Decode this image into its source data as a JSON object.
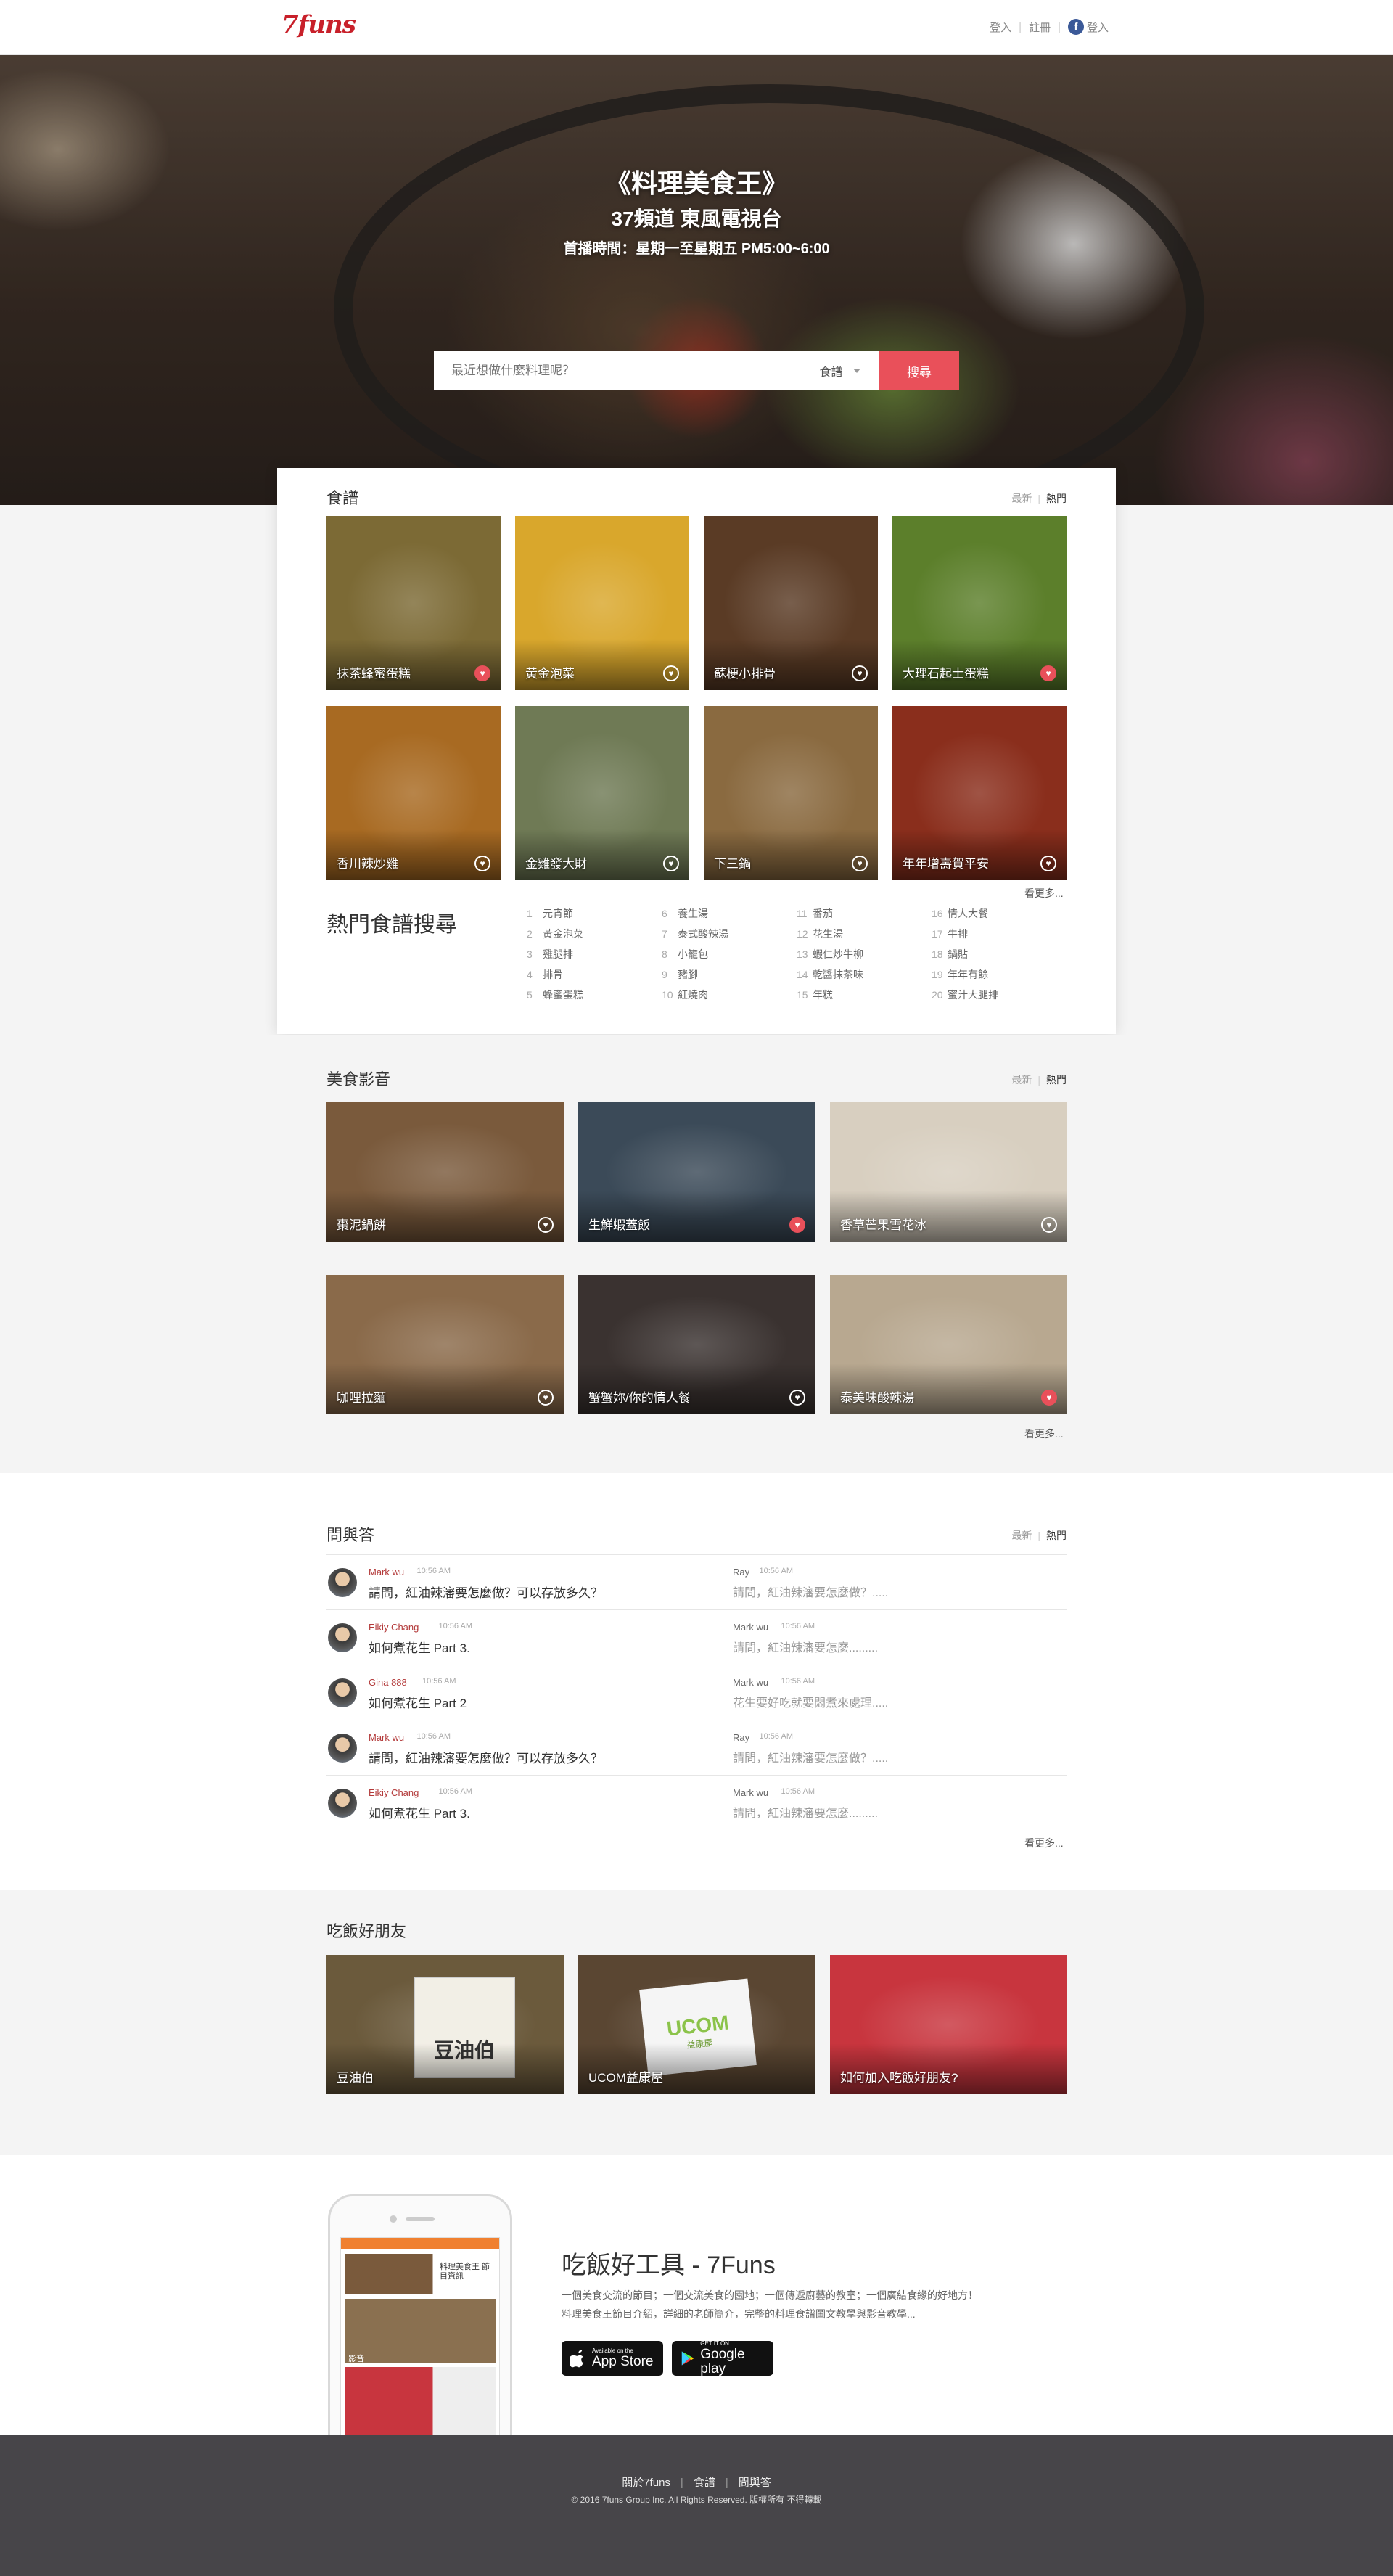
{
  "header": {
    "logo": "7funs",
    "login": "登入",
    "register": "註冊",
    "fb_login": "登入"
  },
  "hero": {
    "title": "《料理美食王》",
    "subtitle": "37頻道 東風電視台",
    "schedule": "首播時間：星期一至星期五 PM5:00~6:00",
    "search_placeholder": "最近想做什麼料理呢？",
    "search_category": "食譜",
    "search_button": "搜尋"
  },
  "recipes": {
    "title": "食譜",
    "sort_new": "最新",
    "sort_hot": "熱門",
    "items": [
      {
        "label": "抹茶蜂蜜蛋糕",
        "liked": true,
        "color": "#7c6a35"
      },
      {
        "label": "黃金泡菜",
        "liked": false,
        "color": "#d9a72c"
      },
      {
        "label": "蘇梗小排骨",
        "liked": false,
        "color": "#5a3b25"
      },
      {
        "label": "大理石起士蛋糕",
        "liked": true,
        "color": "#5c7f2b"
      },
      {
        "label": "香川辣炒雞",
        "liked": false,
        "color": "#a86a22"
      },
      {
        "label": "金雞發大財",
        "liked": false,
        "color": "#6f7a55"
      },
      {
        "label": "下三鍋",
        "liked": false,
        "color": "#8a6a40"
      },
      {
        "label": "年年增壽賀平安",
        "liked": false,
        "color": "#8a2e1c"
      }
    ],
    "more": "看更多..."
  },
  "hot_search": {
    "title": "熱門食譜搜尋",
    "columns": [
      [
        {
          "n": "1",
          "t": "元宵節"
        },
        {
          "n": "2",
          "t": "黃金泡菜"
        },
        {
          "n": "3",
          "t": "雞腿排"
        },
        {
          "n": "4",
          "t": "排骨"
        },
        {
          "n": "5",
          "t": "蜂蜜蛋糕"
        }
      ],
      [
        {
          "n": "6",
          "t": "養生湯"
        },
        {
          "n": "7",
          "t": "泰式酸辣湯"
        },
        {
          "n": "8",
          "t": "小籠包"
        },
        {
          "n": "9",
          "t": "豬腳"
        },
        {
          "n": "10",
          "t": "紅燒肉"
        }
      ],
      [
        {
          "n": "11",
          "t": "番茄"
        },
        {
          "n": "12",
          "t": "花生湯"
        },
        {
          "n": "13",
          "t": "蝦仁炒牛柳"
        },
        {
          "n": "14",
          "t": "乾醬抹茶味"
        },
        {
          "n": "15",
          "t": "年糕"
        }
      ],
      [
        {
          "n": "16",
          "t": "情人大餐"
        },
        {
          "n": "17",
          "t": "牛排"
        },
        {
          "n": "18",
          "t": "鍋貼"
        },
        {
          "n": "19",
          "t": "年年有餘"
        },
        {
          "n": "20",
          "t": "蜜汁大腿排"
        }
      ]
    ]
  },
  "videos": {
    "title": "美食影音",
    "sort_new": "最新",
    "sort_hot": "熱門",
    "items": [
      {
        "label": "棗泥鍋餅",
        "liked": false,
        "color": "#7a5a3c"
      },
      {
        "label": "生鮮蝦蓋飯",
        "liked": true,
        "color": "#3b4a58"
      },
      {
        "label": "香草芒果雪花冰",
        "liked": false,
        "color": "#d8cfc0"
      },
      {
        "label": "咖哩拉麵",
        "liked": false,
        "color": "#8a6a4a"
      },
      {
        "label": "蟹蟹妳/你的情人餐",
        "liked": false,
        "color": "#3a3230"
      },
      {
        "label": "泰美味酸辣湯",
        "liked": true,
        "color": "#b8a890"
      }
    ],
    "more": "看更多..."
  },
  "qa": {
    "title": "問與答",
    "sort_new": "最新",
    "sort_hot": "熱門",
    "rows": [
      {
        "name": "Mark wu",
        "time": "10:56 AM",
        "question": "請問，紅油辣瀋要怎麼做？可以存放多久？",
        "a_name": "Ray",
        "a_time": "10:56 AM",
        "answer": "請問，紅油辣瀋要怎麼做？....."
      },
      {
        "name": "Eikiy Chang",
        "time": "10:56 AM",
        "question": "如何煮花生 Part 3.",
        "a_name": "Mark wu",
        "a_time": "10:56 AM",
        "answer": "請問，紅油辣瀋要怎麼........."
      },
      {
        "name": "Gina 888",
        "time": "10:56 AM",
        "question": "如何煮花生 Part 2",
        "a_name": "Mark wu",
        "a_time": "10:56 AM",
        "answer": "花生要好吃就要悶煮來處理....."
      },
      {
        "name": "Mark wu",
        "time": "10:56 AM",
        "question": "請問，紅油辣瀋要怎麼做？可以存放多久？",
        "a_name": "Ray",
        "a_time": "10:56 AM",
        "answer": "請問，紅油辣瀋要怎麼做？....."
      },
      {
        "name": "Eikiy Chang",
        "time": "10:56 AM",
        "question": "如何煮花生 Part 3.",
        "a_name": "Mark wu",
        "a_time": "10:56 AM",
        "answer": "請問，紅油辣瀋要怎麼........."
      }
    ],
    "more": "看更多..."
  },
  "friends": {
    "title": "吃飯好朋友",
    "items": [
      {
        "label": "豆油伯",
        "color": "#6b5a3c"
      },
      {
        "label": "UCOM益康屋",
        "color": "#5a4632"
      },
      {
        "label": "如何加入吃飯好朋友?",
        "color": "#c8353e"
      }
    ],
    "badge_douyou": "豆油伯",
    "badge_ucom": "UCOM",
    "badge_ucom_cn": "益康屋"
  },
  "app": {
    "title": "吃飯好工具 - 7Funs",
    "desc_line1": "一個美食交流的節目；一個交流美食的園地；一個傳遞廚藝的教室；一個廣結食緣的好地方！",
    "desc_line2": "料理美食王節目介紹，詳細的老師簡介，完整的料理食譜圖文教學與影音教學...",
    "phone_banner": "料理美食王 節目資訊",
    "phone_label": "影音",
    "appstore_small": "Available on the",
    "appstore_big": "App Store",
    "play_small": "GET IT ON",
    "play_big": "Google play"
  },
  "footer": {
    "about": "關於7funs",
    "recipes": "食譜",
    "qa": "問與答",
    "copyright": "© 2016 7funs Group Inc. All Rights Reserved. 版權所有 不得轉載"
  }
}
